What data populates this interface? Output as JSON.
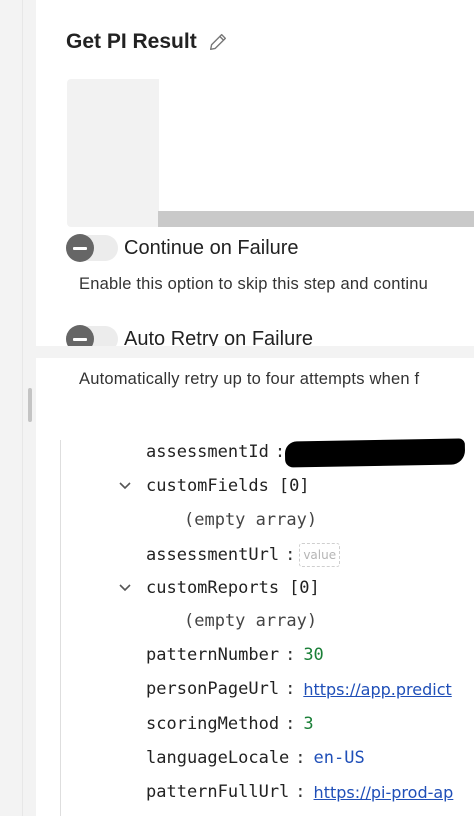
{
  "header": {
    "title": "Get PI Result",
    "edit_icon": "pencil-icon"
  },
  "options": {
    "continue_on_failure": {
      "label": "Continue on Failure",
      "description": "Enable this option to skip this step and continu",
      "enabled": false
    },
    "auto_retry": {
      "label": "Auto Retry on Failure",
      "description": "Automatically retry up to four attempts when f",
      "enabled": false
    }
  },
  "json": {
    "assessmentId_key": "assessmentId",
    "customFields_key": "customFields",
    "customFields_count": "[0]",
    "customFields_empty": "(empty array)",
    "assessmentUrl_key": "assessmentUrl",
    "assessmentUrl_placeholder": "value",
    "customReports_key": "customReports",
    "customReports_count": "[0]",
    "customReports_empty": "(empty array)",
    "patternNumber_key": "patternNumber",
    "patternNumber_value": "30",
    "personPageUrl_key": "personPageUrl",
    "personPageUrl_value": "https://app.predict",
    "scoringMethod_key": "scoringMethod",
    "scoringMethod_value": "3",
    "languageLocale_key": "languageLocale",
    "languageLocale_value": "en-US",
    "patternFullUrl_key": "patternFullUrl",
    "patternFullUrl_value": "https://pi-prod-ap",
    "colon": ":"
  }
}
